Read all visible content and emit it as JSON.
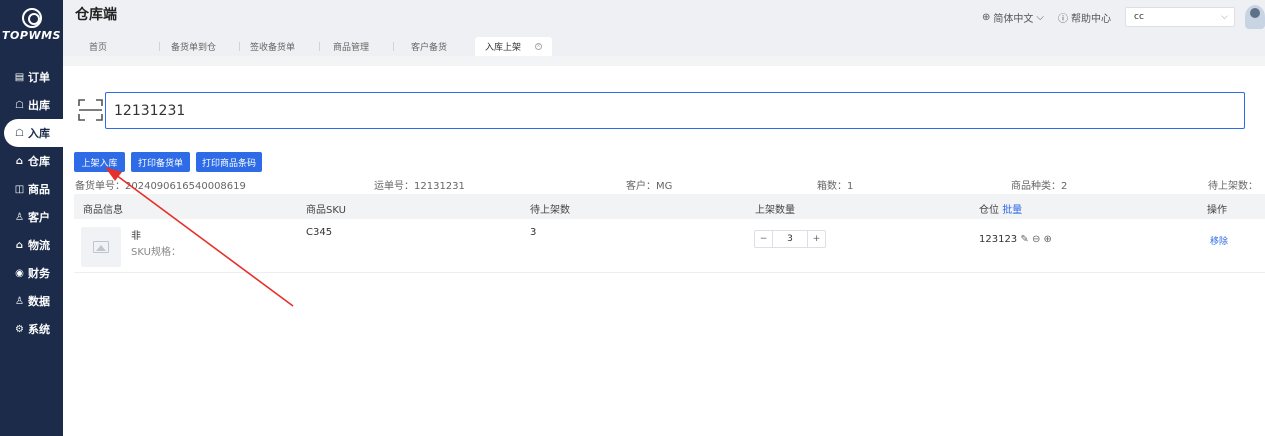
{
  "brand": {
    "name": "TOPWMS"
  },
  "sidebar": {
    "items": [
      {
        "label": "订单",
        "icon": "order-icon"
      },
      {
        "label": "出库",
        "icon": "outbound-icon"
      },
      {
        "label": "入库",
        "icon": "inbound-icon",
        "active": true
      },
      {
        "label": "仓库",
        "icon": "warehouse-icon"
      },
      {
        "label": "商品",
        "icon": "product-icon"
      },
      {
        "label": "客户",
        "icon": "customer-icon"
      },
      {
        "label": "物流",
        "icon": "logistics-icon"
      },
      {
        "label": "财务",
        "icon": "finance-icon"
      },
      {
        "label": "数据",
        "icon": "data-icon"
      },
      {
        "label": "系统",
        "icon": "system-icon"
      }
    ]
  },
  "header": {
    "title": "仓库端",
    "language": "简体中文",
    "help": "帮助中心",
    "user_value": "cc"
  },
  "tabs": [
    {
      "label": "首页"
    },
    {
      "label": "备货单到仓"
    },
    {
      "label": "签收备货单"
    },
    {
      "label": "商品管理"
    },
    {
      "label": "客户备货"
    },
    {
      "label": "入库上架",
      "active": true
    }
  ],
  "scan": {
    "value": "12131231"
  },
  "buttons": {
    "putaway": "上架入库",
    "print_stock": "打印备货单",
    "print_barcode": "打印商品条码"
  },
  "info": {
    "stock_no": "备货单号：2024090616540008619",
    "waybill": "运单号：12131231",
    "customer": "客户：MG",
    "boxes": "箱数：1",
    "sku_types": "商品种类：2",
    "pending": "待上架数："
  },
  "table": {
    "columns": {
      "product_info": "商品信息",
      "sku": "商品SKU",
      "pending_qty": "待上架数",
      "putaway_qty": "上架数量",
      "location": "仓位",
      "location_batch": "批量",
      "action": "操作"
    },
    "rows": [
      {
        "name": "非",
        "spec": "SKU规格：",
        "sku": "C345",
        "pending_qty": "3",
        "putaway_qty": "3",
        "location": "123123",
        "action": "移除"
      }
    ]
  },
  "colors": {
    "primary": "#2e6be6",
    "sidebar": "#1c2b4a",
    "annotation": "#e8302a"
  }
}
